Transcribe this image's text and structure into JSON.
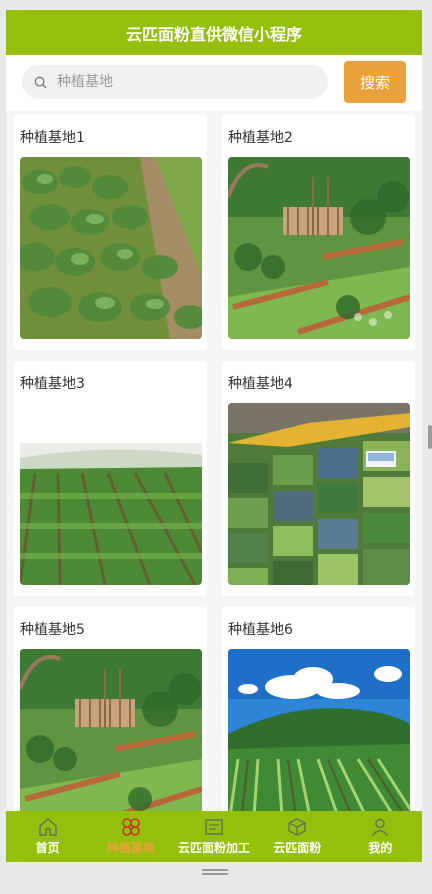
{
  "header": {
    "title": "云匹面粉直供微信小程序"
  },
  "search": {
    "placeholder": "种植基地",
    "button_label": "搜索"
  },
  "cards": [
    {
      "title": "种植基地1"
    },
    {
      "title": "种植基地2"
    },
    {
      "title": "种植基地3"
    },
    {
      "title": "种植基地4"
    },
    {
      "title": "种植基地5"
    },
    {
      "title": "种植基地6"
    }
  ],
  "tabbar": {
    "items": [
      {
        "label": "首页",
        "icon": "home-icon"
      },
      {
        "label": "种植基地",
        "icon": "flower-icon",
        "active": true
      },
      {
        "label": "云匹面粉加工",
        "icon": "factory-icon"
      },
      {
        "label": "云匹面粉",
        "icon": "box-icon"
      },
      {
        "label": "我的",
        "icon": "user-icon"
      }
    ]
  },
  "colors": {
    "brand": "#94bf0b",
    "accent": "#e9a23b",
    "active_tab": "#e8a23a"
  }
}
